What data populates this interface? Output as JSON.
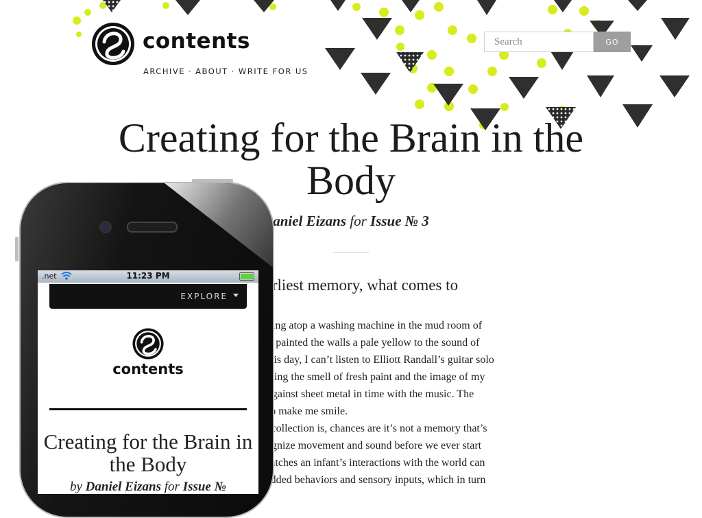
{
  "header": {
    "brand": "contents",
    "nav": [
      "ARCHIVE",
      "ABOUT",
      "WRITE FOR US"
    ],
    "nav_separator": "·",
    "search_placeholder": "Search",
    "go_label": "GO"
  },
  "article": {
    "title": "Creating for the Brain in the Body",
    "byline_author": "aniel Eizans",
    "byline_for": "for",
    "byline_issue": "Issue № 3",
    "lede": "our earliest memory, what comes to",
    "paragraph_lines": [
      "on of sitting atop a washing machine in the mud room of",
      "y parents painted the walls a pale yellow to the sound of",
      "rill. To this day, I can’t listen to Elliott Randall’s guitar solo",
      "out recalling the smell of fresh paint and the image of my",
      "g away against sheet metal in time with the music. The",
      "ver fail to make me smile.",
      "arliest recollection is, chances are it’s not a memory that’s",
      "d to recognize movement and sound before we ever start",
      "e who watches an infant’s interactions with the world can",
      "by embedded behaviors and sensory inputs, which in turn"
    ]
  },
  "phone": {
    "carrier": ".net",
    "time": "11:23 PM",
    "explore_label": "EXPLORE",
    "brand": "contents",
    "title": "Creating for the Brain in the Body",
    "byline_by": "by",
    "byline_author": "Daniel Eizans",
    "byline_for": "for",
    "byline_issue": "Issue №"
  },
  "colors": {
    "accent": "#d7ec1c",
    "go_button": "#9e9e9e",
    "text": "#1a1a1a"
  }
}
